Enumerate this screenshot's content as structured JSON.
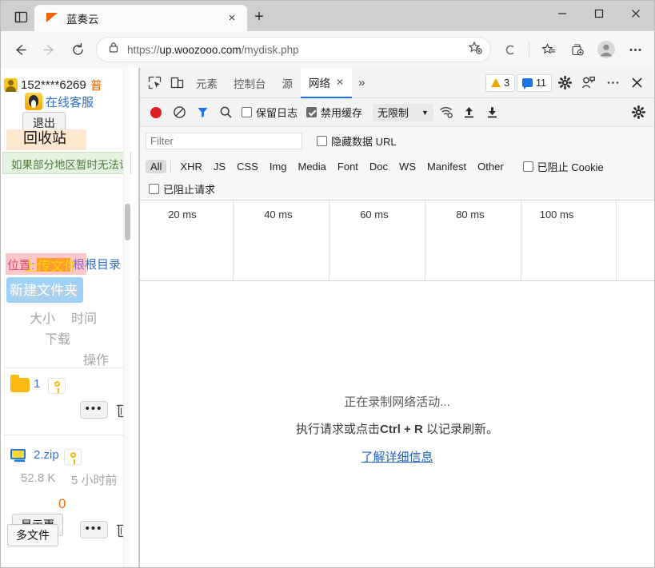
{
  "browser": {
    "tab": {
      "title": "蓝奏云",
      "close_label": "×",
      "favicon": "lanzou-logo-icon"
    },
    "new_tab_label": "+",
    "tab_list_icon": "tab-list-icon",
    "window_controls": {
      "minimize": "−",
      "maximize": "□",
      "close": "✕"
    },
    "nav": {
      "back_icon": "back-arrow-icon",
      "forward_icon": "forward-arrow-icon",
      "reload_icon": "reload-icon",
      "lock_icon": "lock-icon",
      "url_scheme": "https://",
      "url_host": "up.woozooo.com",
      "url_path": "/mydisk.php",
      "favorite_icon": "add-favorite-icon",
      "split_icon": "browser-essentials-icon",
      "collections_icon": "collections-icon",
      "profile_icon": "profile-avatar-icon",
      "settings_icon": "more-options-icon"
    }
  },
  "page": {
    "account_number": "152****6269",
    "account_level": "普",
    "support_label": "在线客服",
    "logout_label": "退出",
    "recycle_label": "回收站",
    "notice_text": "如果部分地区暂时无法访",
    "position_label": "位置:",
    "upload_label": "上传文件",
    "root_label": "根目录",
    "new_folder_label": "新建文件夹",
    "col_size": "大小",
    "col_time": "时间",
    "col_download": "下载",
    "col_action": "操作",
    "rows": [
      {
        "name": "1",
        "icon": "folder-icon",
        "lock": "key-icon",
        "size": "",
        "time": "",
        "downloads": "",
        "menu": "•••",
        "delete": "trash-icon"
      },
      {
        "name": "2.zip",
        "icon": "zip-file-icon",
        "lock": "key-icon",
        "size": "52.8 K",
        "time": "5 小时前",
        "downloads": "0",
        "menu": "•••",
        "delete": "trash-icon"
      }
    ],
    "show_more_line1": "显示更",
    "show_more_line2": "多文件"
  },
  "devtools": {
    "inspect_icon": "inspect-element-icon",
    "device_icon": "device-toolbar-icon",
    "tabs": [
      {
        "label": "元素",
        "active": false
      },
      {
        "label": "控制台",
        "active": false
      },
      {
        "label": "源",
        "active": false
      },
      {
        "label": "网络",
        "active": true,
        "close": "✕"
      }
    ],
    "more_tabs": "»",
    "warning_count": "3",
    "message_count": "11",
    "settings_icon": "gear-icon",
    "feedback_icon": "feedback-icon",
    "more_icon": "more-tools-icon",
    "close_icon": "close-devtools-icon",
    "toolbar": {
      "record_icon": "record-stop-icon",
      "clear_icon": "clear-icon",
      "filter_icon": "filter-funnel-icon",
      "search_icon": "search-icon",
      "preserve_log": {
        "label": "保留日志",
        "checked": false
      },
      "disable_cache": {
        "label": "禁用缓存",
        "checked": true
      },
      "throttle_value": "无限制",
      "throttle_caret": "▼",
      "network_conditions_icon": "network-conditions-icon",
      "import_icon": "import-har-icon",
      "export_icon": "export-har-icon",
      "network_settings_icon": "network-settings-gear-icon"
    },
    "filter": {
      "placeholder": "Filter",
      "value": "",
      "hide_data_urls": {
        "label": "隐藏数据 URL",
        "checked": false
      },
      "types": [
        "All",
        "XHR",
        "JS",
        "CSS",
        "Img",
        "Media",
        "Font",
        "Doc",
        "WS",
        "Manifest",
        "Other"
      ],
      "active_type": "All",
      "blocked_cookies": {
        "label": "已阻止 Cookie",
        "checked": false
      },
      "blocked_requests": {
        "label": "已阻止请求",
        "checked": false
      }
    },
    "timeline": {
      "ticks": [
        "20 ms",
        "40 ms",
        "60 ms",
        "80 ms",
        "100 ms"
      ]
    },
    "empty_state": {
      "line1": "正在录制网络活动...",
      "line2_pre": "执行请求或点击",
      "line2_key": "Ctrl + R",
      "line2_post": " 以记录刷新。",
      "link": "了解详细信息"
    }
  },
  "colors": {
    "accent_blue": "#1a73e8",
    "record_red": "#e02020",
    "warning_orange": "#f2a600",
    "brand_orange": "#f2600c"
  }
}
